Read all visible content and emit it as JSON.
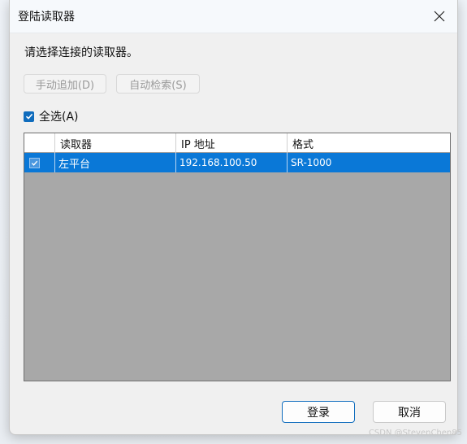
{
  "window": {
    "title": "登陆读取器",
    "close_icon": "close-icon"
  },
  "prompt": "请选择连接的读取器。",
  "toolbar": {
    "manual_add_label": "手动追加(D)",
    "auto_search_label": "自动检索(S)"
  },
  "select_all": {
    "label": "全选(A)",
    "checked": true
  },
  "grid": {
    "columns": [
      "读取器",
      "IP 地址",
      "格式"
    ],
    "rows": [
      {
        "checked": true,
        "name": "左平台",
        "ip": "192.168.100.50",
        "format": "SR-1000"
      }
    ]
  },
  "footer": {
    "ok_label": "登录",
    "cancel_label": "取消"
  },
  "watermark": "CSDN @StevenChen85",
  "colors": {
    "accent": "#0f6cbd",
    "selected_row": "#0a78d7",
    "grid_background": "#a8a8a8"
  }
}
